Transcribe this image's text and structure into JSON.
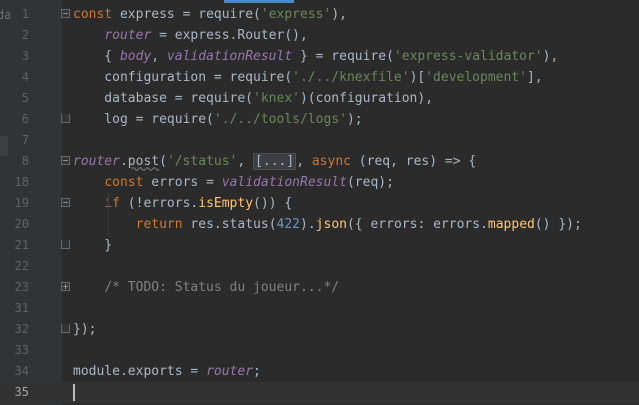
{
  "editor": {
    "left_fragment": "da",
    "lines": [
      {
        "n": "1",
        "fold": "minus",
        "tokens": [
          [
            "kw",
            "const "
          ],
          [
            "plain",
            "express"
          ],
          [
            "plain",
            " = "
          ],
          [
            "plain",
            "require("
          ],
          [
            "str",
            "'express'"
          ],
          [
            "plain",
            "),"
          ]
        ]
      },
      {
        "n": "2",
        "fold": "",
        "tokens": [
          [
            "plain",
            "    "
          ],
          [
            "var",
            "router"
          ],
          [
            "plain",
            " = "
          ],
          [
            "plain",
            "express."
          ],
          [
            "plain",
            "Router"
          ],
          [
            "plain",
            "(),"
          ]
        ]
      },
      {
        "n": "3",
        "fold": "",
        "tokens": [
          [
            "plain",
            "    { "
          ],
          [
            "var",
            "body"
          ],
          [
            "plain",
            ", "
          ],
          [
            "var",
            "validationResult"
          ],
          [
            "plain",
            " } = require("
          ],
          [
            "str",
            "'express-validator'"
          ],
          [
            "plain",
            "),"
          ]
        ]
      },
      {
        "n": "4",
        "fold": "",
        "tokens": [
          [
            "plain",
            "    configuration = require("
          ],
          [
            "str",
            "'./../knexfile'"
          ],
          [
            "plain",
            ")["
          ],
          [
            "str",
            "'development'"
          ],
          [
            "plain",
            "],"
          ]
        ]
      },
      {
        "n": "5",
        "fold": "",
        "tokens": [
          [
            "plain",
            "    database = require("
          ],
          [
            "str",
            "'knex'"
          ],
          [
            "plain",
            ")(configuration),"
          ]
        ]
      },
      {
        "n": "6",
        "fold": "end",
        "tokens": [
          [
            "plain",
            "    log = require("
          ],
          [
            "str",
            "'./../tools/logs'"
          ],
          [
            "plain",
            ");"
          ]
        ]
      },
      {
        "n": "7",
        "fold": "",
        "tokens": []
      },
      {
        "n": "8",
        "fold": "minus",
        "tokens": [
          [
            "var",
            "router"
          ],
          [
            "plain",
            "."
          ],
          [
            "sq",
            "post"
          ],
          [
            "plain",
            "("
          ],
          [
            "str",
            "'/status'"
          ],
          [
            "plain",
            ", "
          ],
          [
            "ph",
            "[...]"
          ],
          [
            "plain",
            ", "
          ],
          [
            "kw",
            "async"
          ],
          [
            "plain",
            " (req, res) => {"
          ]
        ]
      },
      {
        "n": "18",
        "fold": "",
        "tokens": [
          [
            "plain",
            "    "
          ],
          [
            "kw",
            "const "
          ],
          [
            "plain",
            "errors = "
          ],
          [
            "var",
            "validationResult"
          ],
          [
            "plain",
            "(req);"
          ]
        ]
      },
      {
        "n": "19",
        "fold": "minus",
        "tokens": [
          [
            "plain",
            "    "
          ],
          [
            "kw",
            "if "
          ],
          [
            "plain",
            "(!errors."
          ],
          [
            "fn",
            "isEmpty"
          ],
          [
            "plain",
            "()) {"
          ]
        ]
      },
      {
        "n": "20",
        "fold": "",
        "tokens": [
          [
            "plain",
            "        "
          ],
          [
            "kw",
            "return "
          ],
          [
            "plain",
            "res."
          ],
          [
            "plain",
            "status"
          ],
          [
            "plain",
            "("
          ],
          [
            "num",
            "422"
          ],
          [
            "plain",
            ")."
          ],
          [
            "fn",
            "json"
          ],
          [
            "plain",
            "({ "
          ],
          [
            "plain",
            "errors"
          ],
          [
            "plain",
            ": errors."
          ],
          [
            "fn",
            "mapped"
          ],
          [
            "plain",
            "() });"
          ]
        ]
      },
      {
        "n": "21",
        "fold": "end",
        "tokens": [
          [
            "plain",
            "    }"
          ]
        ]
      },
      {
        "n": "22",
        "fold": "",
        "tokens": []
      },
      {
        "n": "23",
        "fold": "plus",
        "tokens": [
          [
            "plain",
            "    "
          ],
          [
            "cmt",
            "/* TODO: Status du joueur...*/"
          ]
        ]
      },
      {
        "n": "31",
        "fold": "",
        "tokens": []
      },
      {
        "n": "32",
        "fold": "end",
        "tokens": [
          [
            "plain",
            "});"
          ]
        ]
      },
      {
        "n": "33",
        "fold": "",
        "tokens": []
      },
      {
        "n": "34",
        "fold": "",
        "tokens": [
          [
            "plain",
            "module."
          ],
          [
            "plain",
            "exports"
          ],
          [
            "plain",
            " = "
          ],
          [
            "var",
            "router"
          ],
          [
            "plain",
            ";"
          ]
        ]
      },
      {
        "n": "35",
        "fold": "",
        "tokens": [],
        "current": true
      }
    ]
  },
  "colors": {
    "background": "#2b2b2b",
    "gutter": "#313335",
    "keyword": "#cc7832",
    "string": "#6a8759",
    "variable": "#9876aa",
    "function": "#ffc66d",
    "number": "#6897bb",
    "comment": "#808080",
    "text": "#a9b7c6"
  }
}
